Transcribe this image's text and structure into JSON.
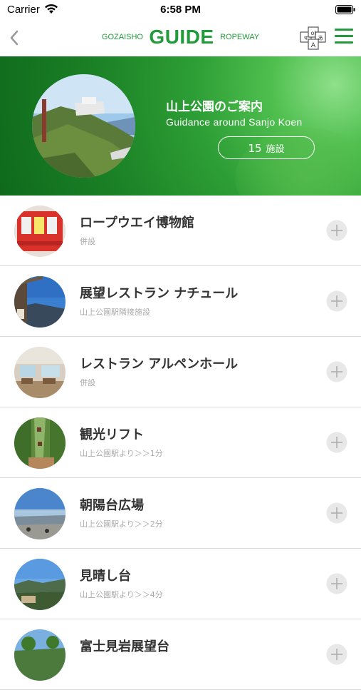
{
  "status_bar": {
    "carrier": "Carrier",
    "time": "6:58 PM"
  },
  "nav": {
    "brand_left": "GOZAISHO",
    "brand_main": "GUIDE",
    "brand_right": "ROPEWAY",
    "lang_glyphs": [
      "ol",
      "あ",
      "ध",
      "A"
    ],
    "accent_color": "#239a3b"
  },
  "hero": {
    "title": "山上公園のご案内",
    "subtitle": "Guidance around Sanjo Koen",
    "count": "15",
    "count_unit": "施設"
  },
  "facilities": [
    {
      "name": "ロープウエイ博物館",
      "desc": "併設",
      "thumb": "ropeway-car"
    },
    {
      "name": "展望レストラン ナチュール",
      "desc": "山上公園駅隣接施設",
      "thumb": "restaurant-view"
    },
    {
      "name": "レストラン アルペンホール",
      "desc": "併設",
      "thumb": "restaurant-interior"
    },
    {
      "name": "観光リフト",
      "desc": "山上公園駅より＞＞1分",
      "thumb": "chairlift"
    },
    {
      "name": "朝陽台広場",
      "desc": "山上公園駅より＞＞2分",
      "thumb": "plaza"
    },
    {
      "name": "見晴し台",
      "desc": "山上公園駅より＞＞4分",
      "thumb": "lookout"
    },
    {
      "name": "富士見岩展望台",
      "desc": "",
      "thumb": "fuji-lookout"
    }
  ]
}
